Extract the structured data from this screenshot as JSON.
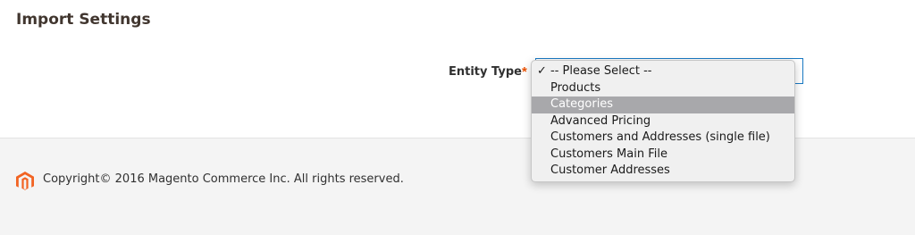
{
  "section": {
    "title": "Import Settings"
  },
  "entity_type": {
    "label": "Entity Type",
    "required_marker": "*",
    "dropdown": {
      "options": [
        {
          "label": "-- Please Select --",
          "checked": true,
          "highlighted": false
        },
        {
          "label": "Products",
          "checked": false,
          "highlighted": false
        },
        {
          "label": "Categories",
          "checked": false,
          "highlighted": true
        },
        {
          "label": "Advanced Pricing",
          "checked": false,
          "highlighted": false
        },
        {
          "label": "Customers and Addresses (single file)",
          "checked": false,
          "highlighted": false
        },
        {
          "label": "Customers Main File",
          "checked": false,
          "highlighted": false
        },
        {
          "label": "Customer Addresses",
          "checked": false,
          "highlighted": false
        }
      ],
      "check_glyph": "✓"
    }
  },
  "footer": {
    "logo_icon": "magento-logo-icon",
    "copyright": "Copyright© 2016 Magento Commerce Inc. All rights reserved."
  },
  "colors": {
    "accent": "#eb5202",
    "focus_border": "#1979c3",
    "highlight": "#a8a8ab",
    "footer_bg": "#f4f4f4"
  }
}
